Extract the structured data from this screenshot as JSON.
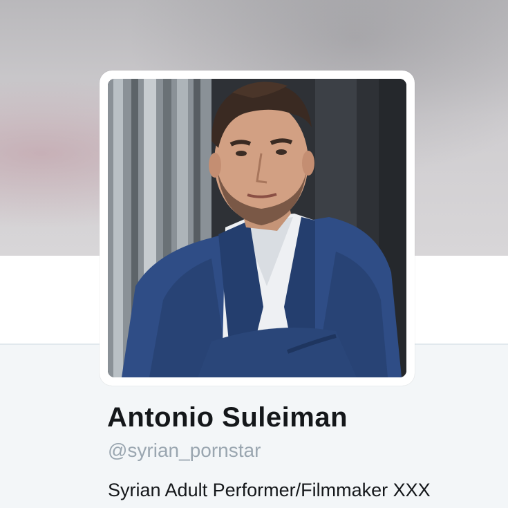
{
  "profile": {
    "name": "Antonio Suleiman",
    "handle": "@syrian_pornstar",
    "bio": "Syrian Adult Performer/Filmmaker XXX"
  },
  "icons": {
    "avatar": "profile-photo"
  },
  "colors": {
    "name_text": "#14171a",
    "handle_text": "#9aa6b0",
    "background": "#f5f8fa",
    "jacket": "#2f4d86"
  }
}
